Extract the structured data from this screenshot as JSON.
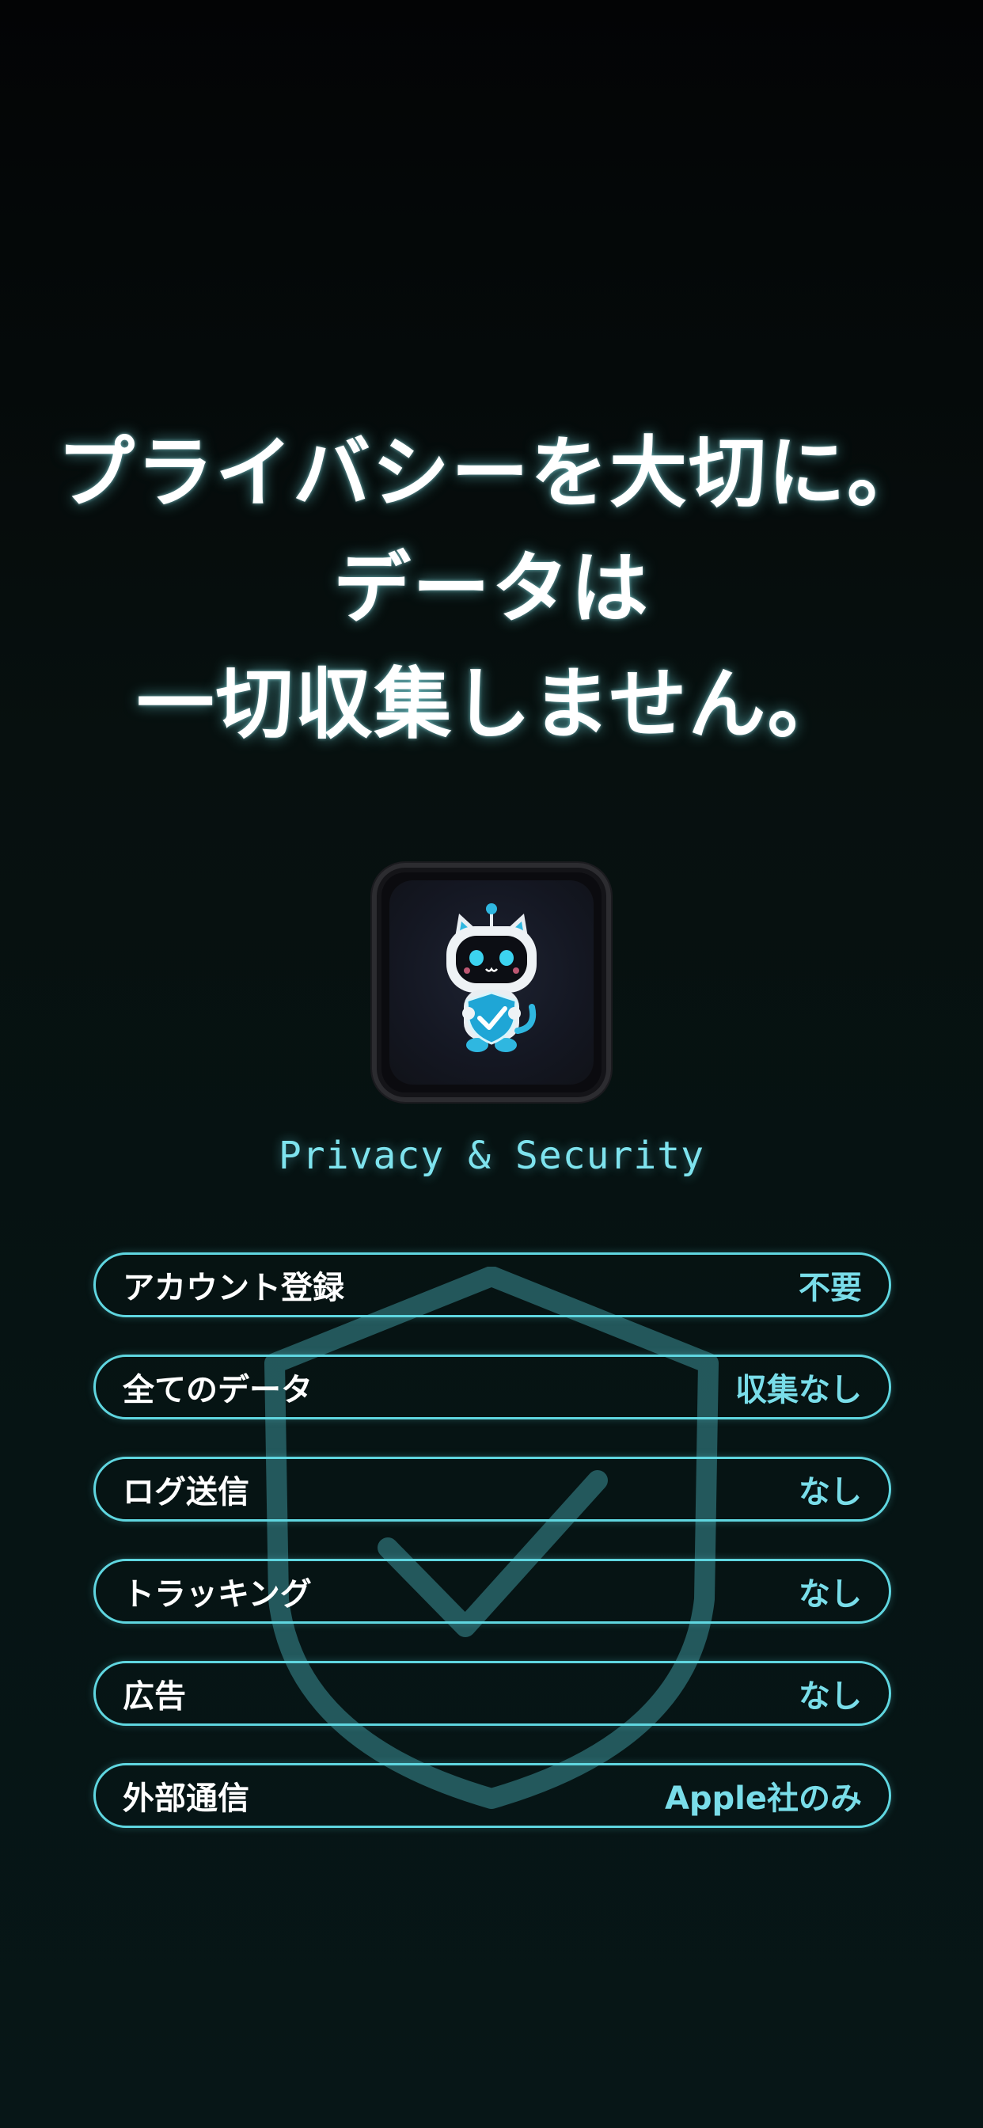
{
  "headline": {
    "line1": "プライバシーを大切に。",
    "line2": "データは",
    "line3": "一切収集しません。"
  },
  "icon": {
    "name": "privacy-cat-robot-mascot"
  },
  "subtitle": "Privacy & Security",
  "rows": [
    {
      "label": "アカウント登録",
      "value": "不要"
    },
    {
      "label": "全てのデータ",
      "value": "収集なし"
    },
    {
      "label": "ログ送信",
      "value": "なし"
    },
    {
      "label": "トラッキング",
      "value": "なし"
    },
    {
      "label": "広告",
      "value": "なし"
    },
    {
      "label": "外部通信",
      "value": "Apple社のみ"
    }
  ],
  "colors": {
    "accent": "#5fd6e0",
    "accent_text": "#79dde9",
    "background": "#061414",
    "text": "#ffffff"
  },
  "background_icon": "shield-check-icon"
}
